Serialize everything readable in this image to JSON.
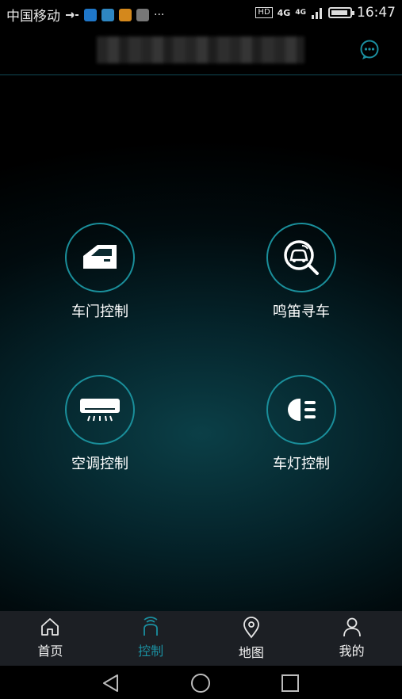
{
  "status_bar": {
    "carrier": "中国移动",
    "hd": "HD",
    "net1": "4G",
    "net2": "4G",
    "time": "16:47",
    "icons": [
      "usb-icon",
      "app-notify-icon-1",
      "app-notify-icon-2",
      "app-notify-icon-3",
      "image-notify-icon",
      "more-dots-icon",
      "signal-icon",
      "battery-icon"
    ]
  },
  "header": {
    "title": "",
    "chat_icon": "chat-bubble-icon"
  },
  "controls": [
    {
      "label": "车门控制",
      "icon": "car-door-icon"
    },
    {
      "label": "鸣笛寻车",
      "icon": "find-car-icon"
    },
    {
      "label": "空调控制",
      "icon": "air-conditioner-icon"
    },
    {
      "label": "车灯控制",
      "icon": "headlight-icon"
    }
  ],
  "bottom_nav": {
    "items": [
      {
        "label": "首页",
        "icon": "home-icon"
      },
      {
        "label": "控制",
        "icon": "control-icon"
      },
      {
        "label": "地图",
        "icon": "map-pin-icon"
      },
      {
        "label": "我的",
        "icon": "user-icon"
      }
    ],
    "active": "控制"
  },
  "colors": {
    "accent": "#1b8fa0",
    "ring": "#1a8f9b",
    "nav_bg": "#1c1f24"
  }
}
